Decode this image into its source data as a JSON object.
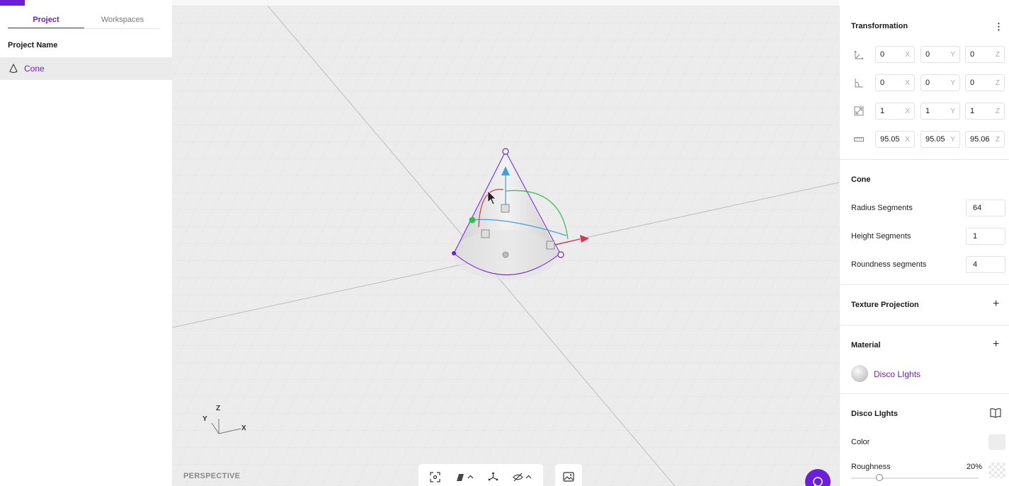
{
  "left_panel": {
    "tabs": [
      {
        "label": "Project",
        "active": true
      },
      {
        "label": "Workspaces",
        "active": false
      }
    ],
    "project_name_label": "Project Name",
    "items": [
      {
        "label": "Cone",
        "icon": "cone-icon",
        "selected": true
      }
    ]
  },
  "viewport": {
    "camera_label": "PERSPECTIVE",
    "axes": {
      "x": "X",
      "y": "Y",
      "z": "Z"
    },
    "toolbar": [
      "focus-icon",
      "shading-icon",
      "gizmo-icon",
      "visibility-icon"
    ],
    "image_button": "image-icon"
  },
  "right_panel": {
    "transformation": {
      "title": "Transformation",
      "rows": [
        {
          "icon": "position-icon",
          "values": [
            "0",
            "0",
            "0"
          ]
        },
        {
          "icon": "rotation-icon",
          "values": [
            "0",
            "0",
            "0"
          ]
        },
        {
          "icon": "scale-icon",
          "values": [
            "1",
            "1",
            "1"
          ]
        },
        {
          "icon": "dimensions-icon",
          "values": [
            "95.05",
            "95.05",
            "95.06"
          ]
        }
      ],
      "axis_labels": [
        "X",
        "Y",
        "Z"
      ]
    },
    "cone": {
      "title": "Cone",
      "radius_segments_label": "Radius Segments",
      "radius_segments": "64",
      "height_segments_label": "Height Segments",
      "height_segments": "1",
      "roundness_segments_label": "Roundness segments",
      "roundness_segments": "4"
    },
    "texture_projection": {
      "title": "Texture Projection"
    },
    "material": {
      "title": "Material",
      "name": "Disco LIghts"
    },
    "disco_lights": {
      "title": "Disco LIghts",
      "color_label": "Color",
      "roughness_label": "Roughness",
      "roughness_value": "20%",
      "roughness_fraction": 0.2
    }
  },
  "colors": {
    "accent": "#6d1ed8",
    "viewport_bg": "#ececec"
  }
}
